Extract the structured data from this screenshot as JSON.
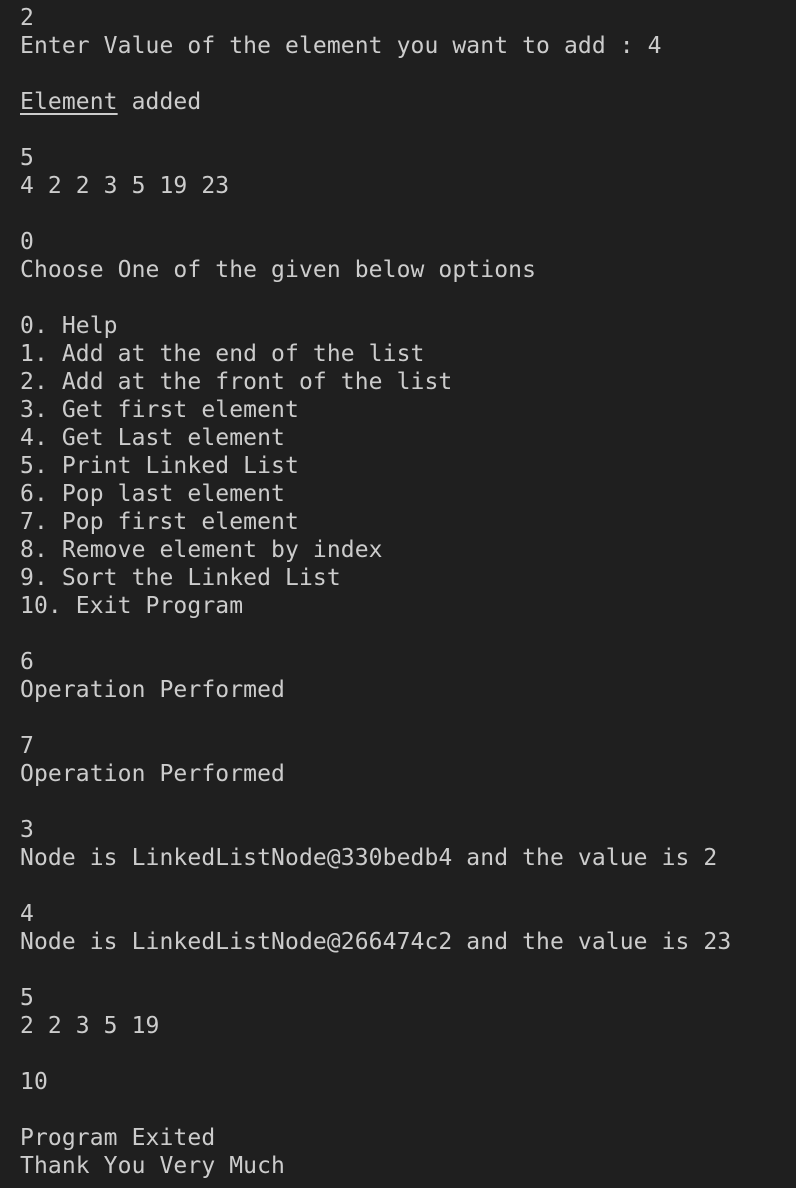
{
  "terminal": {
    "lines": [
      {
        "text": "2"
      },
      {
        "text": "Enter Value of the element you want to add : 4"
      },
      {
        "text": ""
      },
      {
        "segments": [
          {
            "text": "Element",
            "underline": true
          },
          {
            "text": " added"
          }
        ]
      },
      {
        "text": ""
      },
      {
        "text": "5"
      },
      {
        "text": "4 2 2 3 5 19 23"
      },
      {
        "text": ""
      },
      {
        "text": "0"
      },
      {
        "text": "Choose One of the given below options"
      },
      {
        "text": ""
      },
      {
        "text": "0. Help"
      },
      {
        "text": "1. Add at the end of the list"
      },
      {
        "text": "2. Add at the front of the list"
      },
      {
        "text": "3. Get first element"
      },
      {
        "text": "4. Get Last element"
      },
      {
        "text": "5. Print Linked List"
      },
      {
        "text": "6. Pop last element"
      },
      {
        "text": "7. Pop first element"
      },
      {
        "text": "8. Remove element by index"
      },
      {
        "text": "9. Sort the Linked List"
      },
      {
        "text": "10. Exit Program"
      },
      {
        "text": ""
      },
      {
        "text": "6"
      },
      {
        "text": "Operation Performed"
      },
      {
        "text": ""
      },
      {
        "text": "7"
      },
      {
        "text": "Operation Performed"
      },
      {
        "text": ""
      },
      {
        "text": "3"
      },
      {
        "text": "Node is LinkedListNode@330bedb4 and the value is 2"
      },
      {
        "text": ""
      },
      {
        "text": "4"
      },
      {
        "text": "Node is LinkedListNode@266474c2 and the value is 23"
      },
      {
        "text": ""
      },
      {
        "text": "5"
      },
      {
        "text": "2 2 3 5 19"
      },
      {
        "text": ""
      },
      {
        "text": "10"
      },
      {
        "text": ""
      },
      {
        "text": "Program Exited"
      },
      {
        "text": "Thank You Very Much"
      }
    ]
  },
  "colors": {
    "background": "#1f1f1f",
    "foreground": "#cccccc",
    "cursor": "#e6e6e6"
  }
}
